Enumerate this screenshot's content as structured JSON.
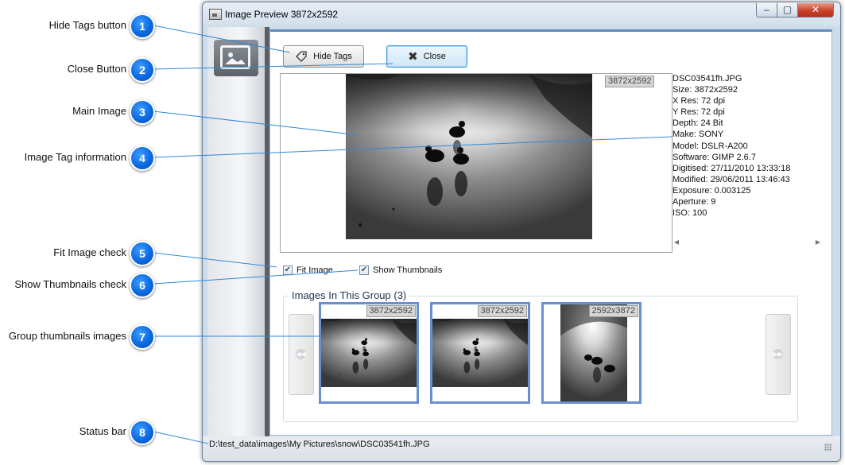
{
  "window": {
    "title": "Image Preview 3872x2592",
    "minimize_glyph": "–",
    "maximize_glyph": "▢",
    "close_glyph": "✕"
  },
  "toolbar": {
    "hide_tags_label": "Hide Tags",
    "close_label": "Close"
  },
  "preview": {
    "dims": "3872x2592"
  },
  "tags": [
    "DSC03541fh.JPG",
    "Size: 3872x2592",
    "X Res: 72 dpi",
    "Y Res: 72 dpi",
    "Depth: 24 Bit",
    "Make: SONY",
    "Model: DSLR-A200",
    "Software: GIMP 2.6.7",
    "Digitised: 27/11/2010 13:33:18",
    "Modified: 29/06/2011 13:46:43",
    "Exposure: 0.003125",
    "Aperture: 9",
    "ISO: 100"
  ],
  "options": {
    "fit_image_label": "Fit Image",
    "fit_image_checked": true,
    "show_thumbnails_label": "Show Thumbnails",
    "show_thumbnails_checked": true
  },
  "group": {
    "title": "Images In This Group (3)",
    "thumbnails": [
      {
        "dims": "3872x2592"
      },
      {
        "dims": "3872x2592"
      },
      {
        "dims": "2592x3872"
      }
    ]
  },
  "statusbar": {
    "path": "D:\\test_data\\images\\My Pictures\\snow\\DSC03541fh.JPG"
  },
  "callouts": [
    {
      "number": "1",
      "label": "Hide Tags button"
    },
    {
      "number": "2",
      "label": "Close Button"
    },
    {
      "number": "3",
      "label": "Main Image"
    },
    {
      "number": "4",
      "label": "Image Tag information"
    },
    {
      "number": "5",
      "label": "Fit Image check"
    },
    {
      "number": "6",
      "label": "Show Thumbnails check"
    },
    {
      "number": "7",
      "label": "Group thumbnails images"
    },
    {
      "number": "8",
      "label": "Status bar"
    }
  ],
  "colors": {
    "callout_blue": "#0a6ae0",
    "leader_line": "#2f8ad8",
    "selection_border": "#6a8fd4",
    "window_frame": "#cddbea"
  }
}
